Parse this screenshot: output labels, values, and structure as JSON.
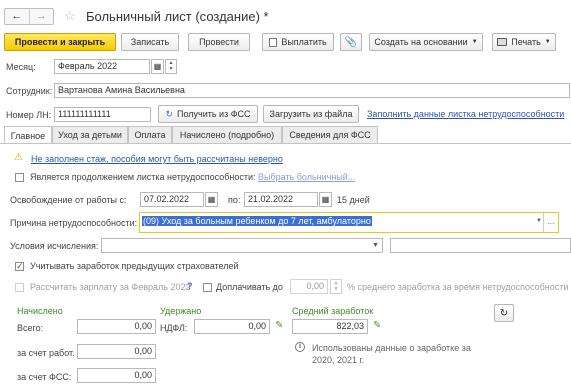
{
  "window": {
    "title": "Больничный лист (создание) *",
    "star_icon": "star-icon",
    "back_icon": "arrow-left-icon",
    "forward_icon": "arrow-right-icon"
  },
  "toolbar": {
    "post_close": "Провести и закрыть",
    "save": "Записать",
    "post": "Провести",
    "payout": "Выплатить",
    "create_based": "Создать на основании",
    "print": "Печать"
  },
  "header": {
    "month_label": "Месяц:",
    "month_value": "Февраль 2022",
    "employee_label": "Сотрудник:",
    "employee_value": "Вартанова Амина Васильевна",
    "ln_label": "Номер ЛН:",
    "ln_value": "111111111111",
    "get_fss": "Получить из ФСС",
    "load_file": "Загрузить из файла",
    "fill_link": "Заполнить данные листка нетрудоспособности"
  },
  "tabs": [
    {
      "label": "Главное",
      "active": true
    },
    {
      "label": "Уход за детьми",
      "active": false
    },
    {
      "label": "Оплата",
      "active": false
    },
    {
      "label": "Начислено (подробно)",
      "active": false
    },
    {
      "label": "Сведения для ФСС",
      "active": false
    }
  ],
  "main": {
    "warning_text": "Не заполнен стаж, пособия могут быть рассчитаны неверно",
    "continuation_label": "Является продолжением листка нетрудоспособности:",
    "choose_sick_leave": "Выбрать больничный...",
    "release_label": "Освобождение от работы с:",
    "date_from": "07.02.2022",
    "to_label": "по:",
    "date_to": "21.02.2022",
    "days": "15 дней",
    "reason_label": "Причина нетрудоспособности:",
    "reason_value": "(09) Уход за больным ребенком до 7 лет, амбулаторно",
    "calc_label": "Условия исчисления:",
    "prev_insurers_label": "Учитывать заработок предыдущих страхователей",
    "prev_insurers_checked": true,
    "calc_salary_label": "Рассчитать зарплату за Февраль 2022",
    "question": "?",
    "extra_pay_label": "Доплачивать до",
    "extra_pay_value": "0,00",
    "avg_percent_label": "% среднего заработка за время нетрудоспособности"
  },
  "totals": {
    "accrued_title": "Начислено",
    "total_label": "Всего:",
    "total_value": "0,00",
    "employer_label": "за счет работ.",
    "employer_value": "0,00",
    "fss_label": "за счет ФСС:",
    "fss_value": "0,00",
    "withheld_title": "Удержано",
    "ndfl_label": "НДФЛ:",
    "ndfl_value": "0,00",
    "avg_title": "Средний заработок",
    "avg_value": "822,03",
    "info_text_1": "Использованы данные о заработке за",
    "info_text_2": "2020,  2021 г."
  },
  "colors": {
    "accent_yellow": "#f5cc00",
    "link_blue": "#2a56b5",
    "green": "#3e8a2e",
    "selection": "#3b6fd4",
    "reason_border": "#f0c419"
  }
}
